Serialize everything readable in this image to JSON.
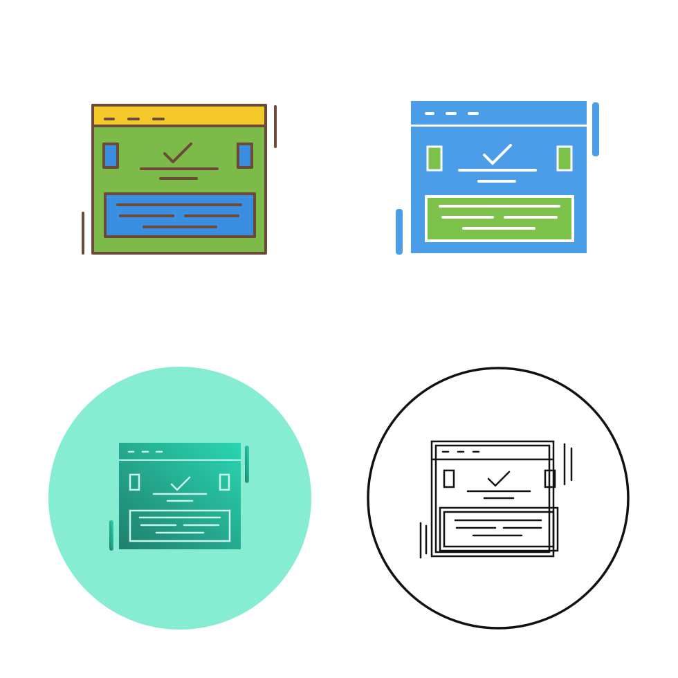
{
  "colors": {
    "background": "#ffffff",
    "outline_brown": "#6b4a38",
    "header_yellow": "#f5c82a",
    "panel_green": "#7cba4a",
    "block_blue": "#3b8fe0",
    "glyph_blue": "#4a9de6",
    "glyph_green": "#7cc24a",
    "circle_teal": "#86ecd2",
    "gradient_start": "#1f7f6d",
    "gradient_end": "#2ad6b2",
    "outline_black": "#111111"
  },
  "icons": [
    {
      "name": "web-page-approved-icon",
      "style": "filled-outline"
    },
    {
      "name": "web-page-approved-icon",
      "style": "glyph"
    },
    {
      "name": "web-page-approved-icon",
      "style": "gradient-in-circle"
    },
    {
      "name": "web-page-approved-icon",
      "style": "line-in-circle"
    }
  ]
}
